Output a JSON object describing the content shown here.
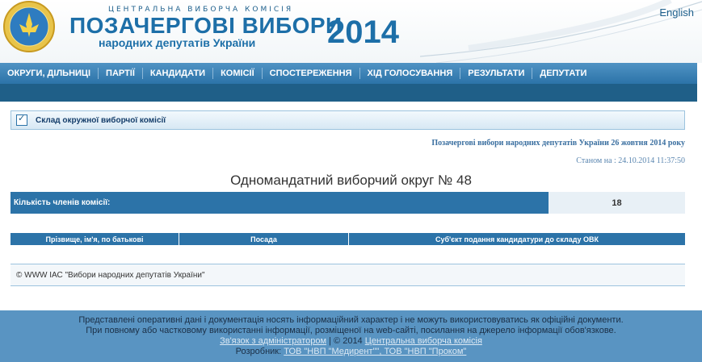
{
  "header": {
    "top_line": "ЦЕНТРАЛЬНА ВИБОРЧА КОМІСІЯ",
    "title": "ПОЗАЧЕРГОВІ ВИБОРИ",
    "subtitle": "народних депутатів України",
    "year": "2014",
    "language_link": "English",
    "emblem_icon": "cec-emblem-icon"
  },
  "nav": {
    "items": [
      "ОКРУГИ, ДІЛЬНИЦІ",
      "ПАРТІЇ",
      "КАНДИДАТИ",
      "КОМІСІЇ",
      "СПОСТЕРЕЖЕННЯ",
      "ХІД ГОЛОСУВАННЯ",
      "РЕЗУЛЬТАТИ",
      "ДЕПУТАТИ"
    ]
  },
  "panel": {
    "title": "Склад окружної виборчої комісії",
    "icon": "checkbox-icon"
  },
  "election_info": "Позачергові вибори народних депутатів України 26 жовтня 2014 року",
  "status": "Станом на : 24.10.2014 11:37:50",
  "district_title": "Одномандатний виборчий округ № 48",
  "members": {
    "label": "Кількість членів комісії:",
    "value": "18"
  },
  "table": {
    "columns": [
      "Прізвище, ім'я, по батькові",
      "Посада",
      "Суб'єкт подання кандидатури до складу ОВК"
    ]
  },
  "copyright": "© WWW ІАС \"Вибори народних депутатів України\"",
  "footer": {
    "line1": "Представлені оперативні дані і документація носять інформаційний характер і не можуть використовуватись як офіційні документи.",
    "line2": "При повному або частковому використанні інформації, розміщеної на web-сайті, посилання на джерело інформації обов'язкове.",
    "contact_link": "Зв'язок з адміністратором",
    "copyright_sep": " | © 2014 ",
    "cec_link": "Центральна виборча комісія",
    "developer_label": "Розробник: ",
    "developer_link": "ТОВ \"НВП \"Медирент\"\", ТОВ \"НВП \"Проком\""
  },
  "colors": {
    "brand_blue": "#1d6fa8",
    "nav_blue": "#2c73a8",
    "footer_blue": "#5994c2"
  }
}
